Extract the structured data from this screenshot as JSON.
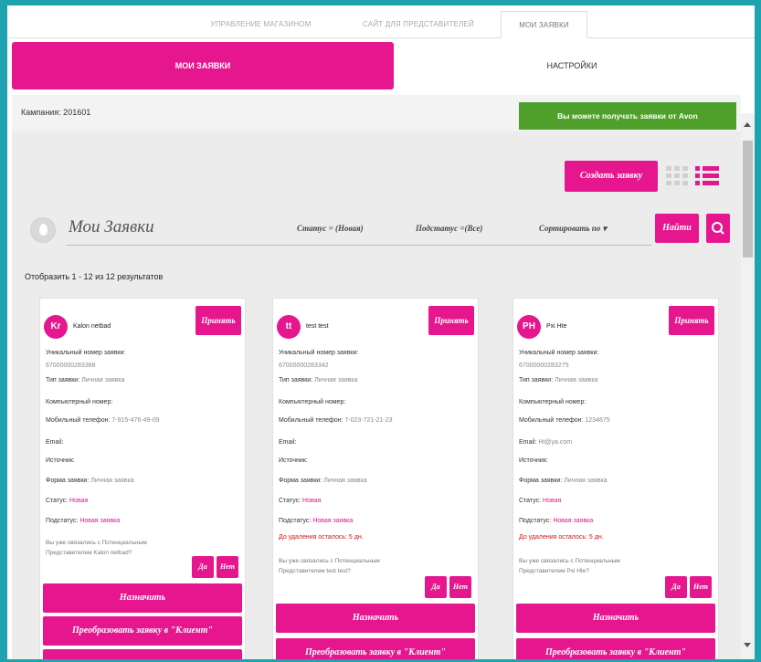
{
  "top_tabs": [
    {
      "label": "УПРАВЛЕНИЕ МАГАЗИНОМ"
    },
    {
      "label": "САЙТ ДЛЯ ПРЕДСТАВИТЕЛЕЙ"
    },
    {
      "label": "МОИ ЗАЯВКИ"
    }
  ],
  "nav": {
    "active": "МОИ ЗАЯВКИ",
    "other": "НАСТРОЙКИ"
  },
  "campaign": {
    "label": "Кампания: 201601",
    "badge": "Вы можете получать заявки от Avon"
  },
  "toolbar": {
    "create_label": "Создать заявку",
    "view_grid_icon": "grid-view-icon",
    "view_list_icon": "list-view-icon"
  },
  "search": {
    "title": "Мои Заявки",
    "status_filter": "Статус = (Новая)",
    "subtype_filter": "Подстатус =(Все)",
    "sort_label": "Сортировать по ▾",
    "find_label": "Найти"
  },
  "results_info": "Отобразить 1 - 12 из 12 результатов",
  "labels": {
    "accept": "Принять",
    "unique_id": "Уникальный номер заявки:",
    "request_type": "Тип заявки:",
    "computer_no": "Компьютерный номер:",
    "mobile": "Мобильный телефон:",
    "email": "Email:",
    "source": "Источник:",
    "form": "Форма заявки:",
    "status": "Статус:",
    "substatus": "Подстатус:",
    "deletion": "До удаления осталось:",
    "yes": "Да",
    "no": "Нет",
    "assign": "Назначить",
    "convert": "Преобразовать заявку в \"Клиент\""
  },
  "cards": [
    {
      "initials": "Kr",
      "name": "Kalon netbad",
      "id": "67000000283388",
      "type": "Личная заявка",
      "mobile": "7-915-476-49-09",
      "email": "",
      "form": "Личная заявка",
      "status": "Новая",
      "substatus": "Новая заявка",
      "deletion": "",
      "question": "Вы уже связались с Потенциальным Представителем Kalon netbad?"
    },
    {
      "initials": "tt",
      "name": "test test",
      "id": "67000000283342",
      "type": "Личная заявка",
      "mobile": "7-023-721-21-23",
      "email": "",
      "form": "Личная заявка",
      "status": "Новая",
      "substatus": "Новая заявка",
      "deletion": "5 дн.",
      "question": "Вы уже связались с Потенциальным Представителем test test?"
    },
    {
      "initials": "PH",
      "name": "Pxi Hte",
      "id": "67000000283275",
      "type": "Личная заявка",
      "mobile": "1234675",
      "email": "Ht@ya.com",
      "form": "Личная заявка",
      "status": "Новая",
      "substatus": "Новая заявка",
      "deletion": "5 дн.",
      "question": "Вы уже связались с Потенциальным Представителем Pxi Hte?"
    }
  ]
}
